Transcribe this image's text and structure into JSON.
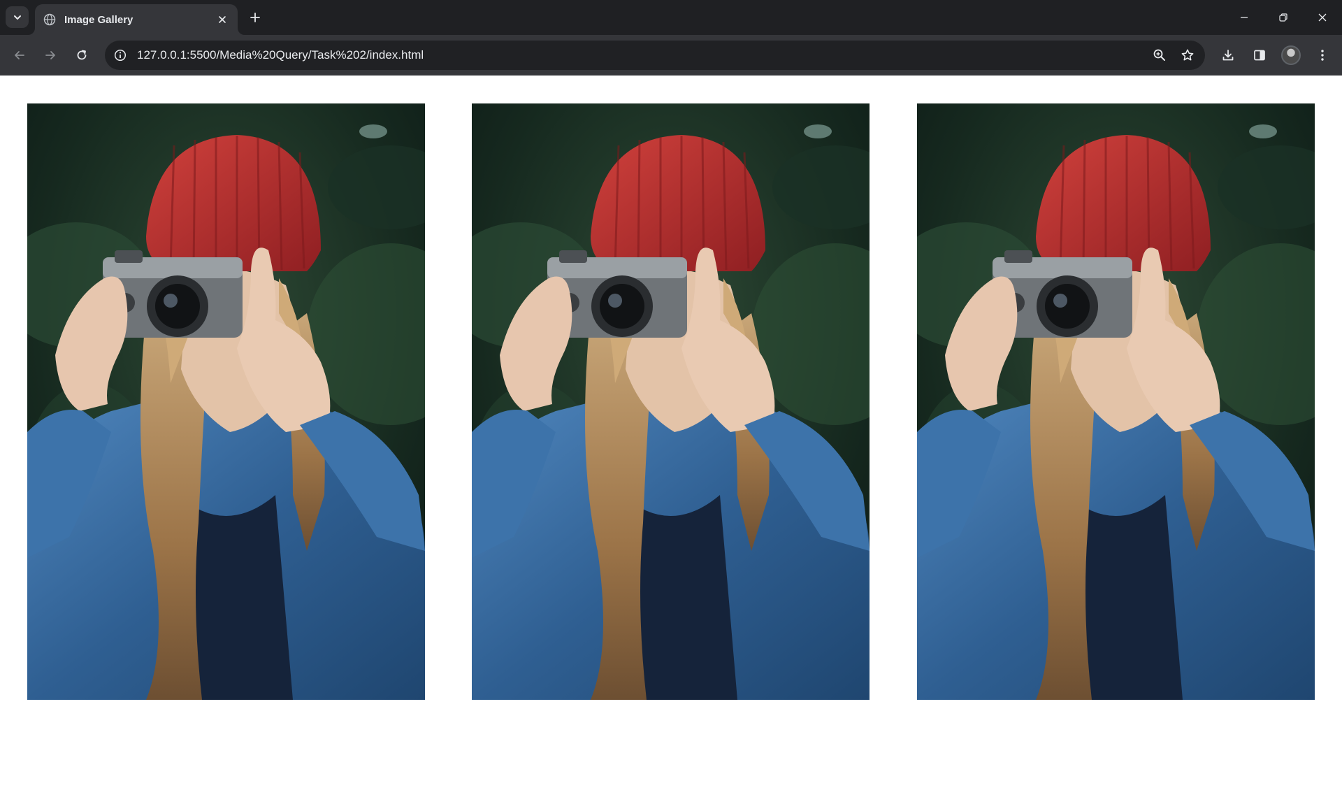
{
  "browser": {
    "tab_title": "Image Gallery",
    "url": "127.0.0.1:5500/Media%20Query/Task%202/index.html",
    "icons": {
      "tab_search": "chevron-down-icon",
      "favicon": "globe-icon",
      "tab_close": "close-icon",
      "new_tab": "plus-icon",
      "minimize": "minimize-icon",
      "restore": "restore-icon",
      "close_window": "close-icon",
      "back": "arrow-left-icon",
      "forward": "arrow-right-icon",
      "reload": "reload-icon",
      "site_info": "info-icon",
      "zoom": "zoom-icon",
      "bookmark": "star-icon",
      "downloads": "download-icon",
      "side_panel": "side-panel-icon",
      "profile": "avatar",
      "menu": "kebab-menu-icon"
    }
  },
  "gallery": {
    "images": [
      {
        "subject": "woman-with-camera-photo"
      },
      {
        "subject": "woman-with-camera-photo"
      },
      {
        "subject": "woman-with-camera-photo"
      }
    ]
  },
  "colors": {
    "chrome_dark": "#1f2023",
    "chrome_toolbar": "#35363a",
    "omnibox": "#202124",
    "text": "#e8eaed",
    "page_bg": "#ffffff",
    "beanie_red": "#b8302e",
    "denim_blue": "#3b6fa0",
    "foliage_green": "#1f3a2a"
  }
}
